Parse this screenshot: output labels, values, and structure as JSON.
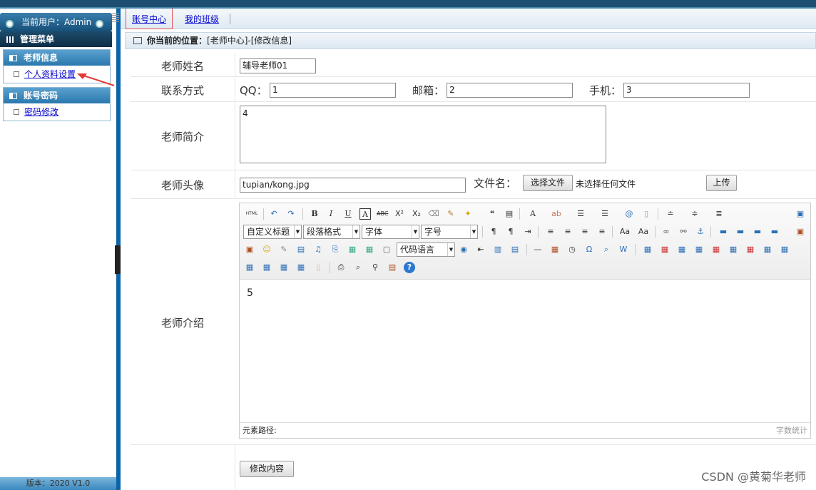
{
  "sidebar": {
    "user_label": "当前用户：Admin",
    "menu_title": "管理菜单",
    "groups": [
      {
        "title": "老师信息",
        "items": [
          {
            "label": "个人资料设置"
          }
        ]
      },
      {
        "title": "账号密码",
        "items": [
          {
            "label": "密码修改"
          }
        ]
      }
    ],
    "version": "版本：2020 V1.0"
  },
  "tabs": [
    {
      "label": "账号中心",
      "active": true
    },
    {
      "label": "我的班级",
      "active": false
    }
  ],
  "location": {
    "prefix": "你当前的位置：",
    "path": "[老师中心]-[修改信息]"
  },
  "form": {
    "name": {
      "label": "老师姓名",
      "value": "辅导老师01"
    },
    "contact": {
      "label": "联系方式",
      "qq_label": "QQ：",
      "qq_value": "1",
      "email_label": "邮箱：",
      "email_value": "2",
      "phone_label": "手机：",
      "phone_value": "3"
    },
    "intro": {
      "label": "老师简介",
      "value": "4"
    },
    "avatar": {
      "label": "老师头像",
      "path_value": "tupian/kong.jpg",
      "file_label": "文件名：",
      "choose_button": "选择文件",
      "no_file_text": "未选择任何文件",
      "upload_button": "上传"
    },
    "detail": {
      "label": "老师介绍",
      "content": "5",
      "path_label": "元素路径:",
      "word_count_label": "字数统计"
    },
    "submit_button": "修改内容"
  },
  "editor_toolbar": {
    "combos": [
      "自定义标题",
      "段落格式",
      "字体",
      "字号",
      "代码语言"
    ]
  },
  "watermark": "CSDN @黄菊华老师",
  "colors": {
    "accent": "#0b63a8",
    "link": "#0000cc",
    "highlight": "#e05252"
  }
}
